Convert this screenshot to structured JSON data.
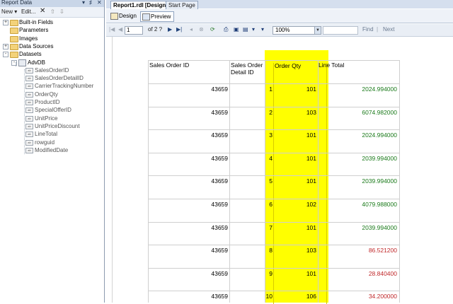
{
  "left_pane": {
    "title": "Report Data",
    "controls": [
      "▾",
      "♯",
      "✕"
    ],
    "toolbar": {
      "new": "New ▾",
      "edit": "Edit...",
      "delete": "✕",
      "up": "⇧",
      "down": "⇩"
    },
    "tree": [
      {
        "label": "Built-in Fields",
        "kind": "folder",
        "expander": "+"
      },
      {
        "label": "Parameters",
        "kind": "folder",
        "expander": ""
      },
      {
        "label": "Images",
        "kind": "folder",
        "expander": ""
      },
      {
        "label": "Data Sources",
        "kind": "folder",
        "expander": "+"
      },
      {
        "label": "Datasets",
        "kind": "folder",
        "expander": "-"
      },
      {
        "label": "AdvDB",
        "kind": "dataset",
        "expander": "-"
      },
      {
        "label": "SalesOrderID",
        "kind": "field"
      },
      {
        "label": "SalesOrderDetailID",
        "kind": "field"
      },
      {
        "label": "CarrierTrackingNumber",
        "kind": "field"
      },
      {
        "label": "OrderQty",
        "kind": "field"
      },
      {
        "label": "ProductID",
        "kind": "field"
      },
      {
        "label": "SpecialOfferID",
        "kind": "field"
      },
      {
        "label": "UnitPrice",
        "kind": "field"
      },
      {
        "label": "UnitPriceDiscount",
        "kind": "field"
      },
      {
        "label": "LineTotal",
        "kind": "field"
      },
      {
        "label": "rowguid",
        "kind": "field"
      },
      {
        "label": "ModifiedDate",
        "kind": "field"
      }
    ]
  },
  "doc_tabs": {
    "active": "Report1.rdl [Design]",
    "other": "Start Page"
  },
  "view_tabs": {
    "design": "Design",
    "preview": "Preview"
  },
  "report_toolbar": {
    "page": "1",
    "of_pages": "of 2 ?",
    "zoom": "100%",
    "find": "Find",
    "separator": "|",
    "next": "Next"
  },
  "table": {
    "headers": [
      "Sales Order ID",
      "Sales Order Detail ID",
      "Order Qty",
      "Line Total"
    ],
    "rows": [
      {
        "order_id": "43659",
        "detail_id": "1",
        "qty": "101",
        "total": "2024.994000",
        "color": "#1a7a1a"
      },
      {
        "order_id": "43659",
        "detail_id": "2",
        "qty": "103",
        "total": "6074.982000",
        "color": "#1a7a1a"
      },
      {
        "order_id": "43659",
        "detail_id": "3",
        "qty": "101",
        "total": "2024.994000",
        "color": "#1a7a1a"
      },
      {
        "order_id": "43659",
        "detail_id": "4",
        "qty": "101",
        "total": "2039.994000",
        "color": "#1a7a1a"
      },
      {
        "order_id": "43659",
        "detail_id": "5",
        "qty": "101",
        "total": "2039.994000",
        "color": "#1a7a1a"
      },
      {
        "order_id": "43659",
        "detail_id": "6",
        "qty": "102",
        "total": "4079.988000",
        "color": "#1a7a1a"
      },
      {
        "order_id": "43659",
        "detail_id": "7",
        "qty": "101",
        "total": "2039.994000",
        "color": "#1a7a1a"
      },
      {
        "order_id": "43659",
        "detail_id": "8",
        "qty": "103",
        "total": "86.521200",
        "color": "#c0282a"
      },
      {
        "order_id": "43659",
        "detail_id": "9",
        "qty": "101",
        "total": "28.840400",
        "color": "#c0282a"
      },
      {
        "order_id": "43659",
        "detail_id": "10",
        "qty": "106",
        "total": "34.200000",
        "color": "#c0282a"
      }
    ],
    "highlight_color": "#ffff00"
  }
}
